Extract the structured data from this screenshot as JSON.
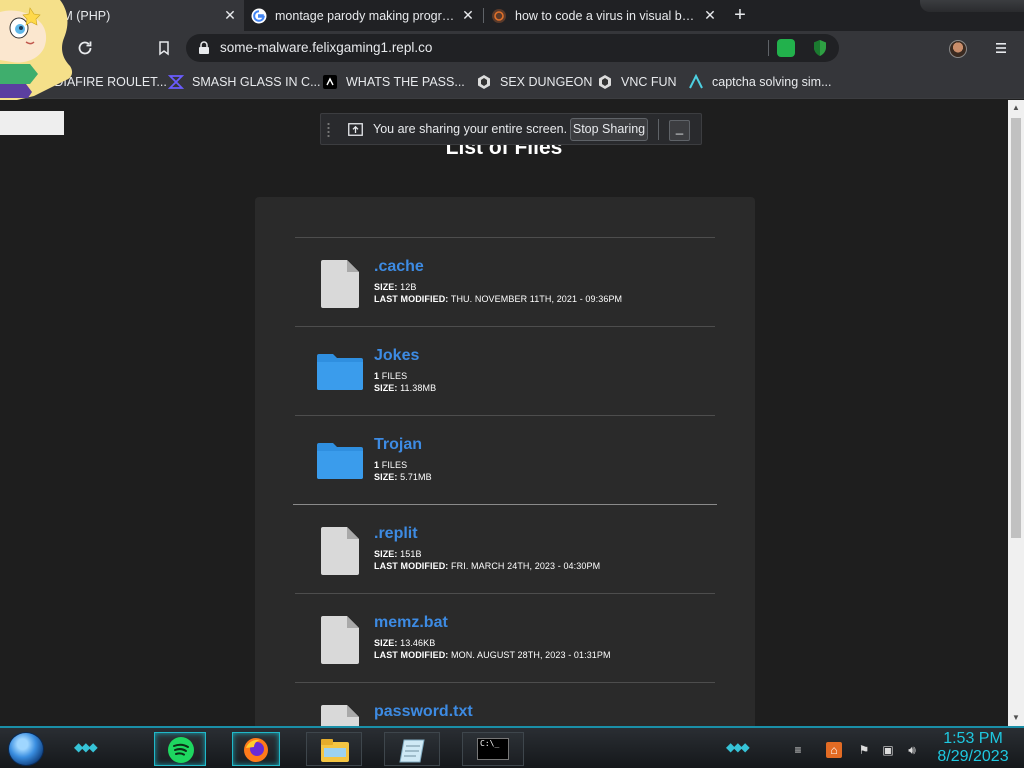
{
  "browser": {
    "tabs": [
      {
        "title": "VM (PHP)",
        "icon": "replit-icon",
        "active": true
      },
      {
        "title": "montage parody making program",
        "icon": "google-icon",
        "active": false
      },
      {
        "title": "how to code a virus in visual basic",
        "icon": "ubuntu-forum-icon",
        "active": false
      }
    ],
    "close_glyph": "✕",
    "new_tab_glyph": "+",
    "url": "some-malware.felixgaming1.repl.co",
    "bookmarks": [
      {
        "label": "EDIAFIRE ROULET...",
        "icon": "mediafire-icon"
      },
      {
        "label": "SMASH GLASS IN C...",
        "icon": "smash-icon"
      },
      {
        "label": "WHATS THE PASS...",
        "icon": "terminal-icon"
      },
      {
        "label": "SEX DUNGEON",
        "icon": "vm-icon"
      },
      {
        "label": "VNC FUN",
        "icon": "vnc-icon"
      },
      {
        "label": "captcha solving sim...",
        "icon": "arrow-a-icon"
      }
    ]
  },
  "share_banner": {
    "text": "You are sharing your entire screen.",
    "stop_label": "Stop Sharing",
    "hide_label": "_"
  },
  "page": {
    "title": "List of Files",
    "files": [
      {
        "name": ".cache",
        "type": "file",
        "meta1_label": "SIZE:",
        "meta1_value": "12B",
        "meta2_label": "LAST MODIFIED:",
        "meta2_value": "THU. NOVEMBER 11TH, 2021 - 09:36PM"
      },
      {
        "name": "Jokes",
        "type": "folder",
        "meta1_label": "1",
        "meta1_value": "FILES",
        "meta2_label": "SIZE:",
        "meta2_value": "11.38MB"
      },
      {
        "name": "Trojan",
        "type": "folder",
        "meta1_label": "1",
        "meta1_value": "FILES",
        "meta2_label": "SIZE:",
        "meta2_value": "5.71MB"
      },
      {
        "name": ".replit",
        "type": "file",
        "meta1_label": "SIZE:",
        "meta1_value": "151B",
        "meta2_label": "LAST MODIFIED:",
        "meta2_value": "FRI. MARCH 24TH, 2023 - 04:30PM"
      },
      {
        "name": "memz.bat",
        "type": "file",
        "meta1_label": "SIZE:",
        "meta1_value": "13.46KB",
        "meta2_label": "LAST MODIFIED:",
        "meta2_value": "MON. AUGUST 28TH, 2023 - 01:31PM"
      },
      {
        "name": "password.txt",
        "type": "file",
        "meta1_label": "",
        "meta1_value": "",
        "meta2_label": "",
        "meta2_value": ""
      }
    ]
  },
  "taskbar": {
    "apps": [
      "spotify-icon",
      "firefox-icon",
      "file-explorer-icon",
      "notepad-icon",
      "cmd-icon"
    ],
    "cmd_prompt": "C:\\_",
    "tray_icons": [
      "network-icon",
      "flag-icon",
      "monitor-icon",
      "volume-icon"
    ],
    "time": "1:53 PM",
    "date": "8/29/2023"
  },
  "colors": {
    "link": "#3d8be3",
    "accent_cyan": "#1ec8e0",
    "folder": "#2f8fe0"
  }
}
